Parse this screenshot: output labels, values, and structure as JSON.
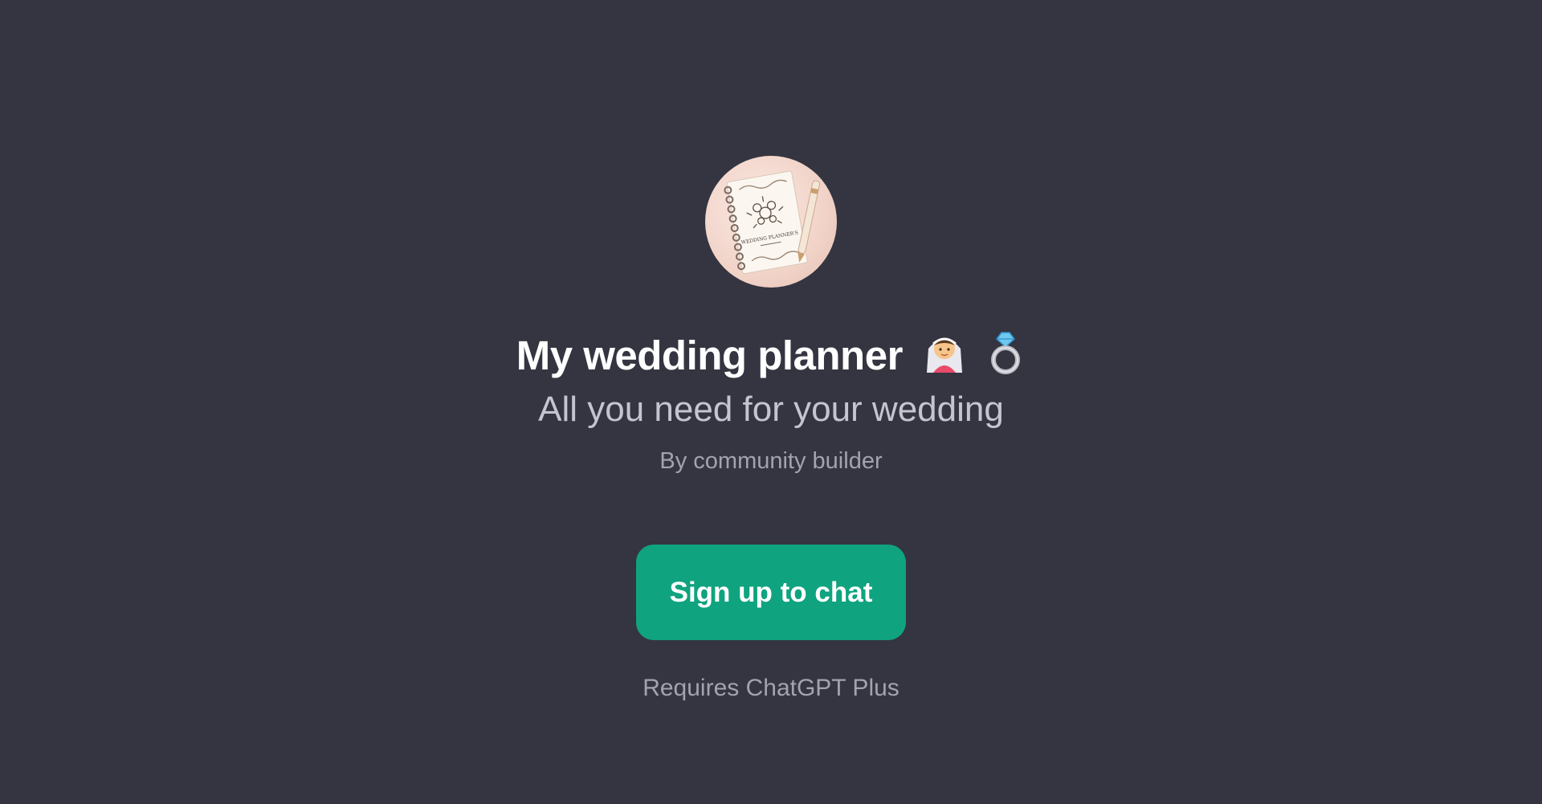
{
  "gpt": {
    "title": "My wedding planner",
    "title_emojis": [
      "bride-with-veil-icon",
      "ring-icon"
    ],
    "subtitle": "All you need for your wedding",
    "author": "By community builder",
    "avatar_text": "WEDDING PLANNER'S"
  },
  "cta": {
    "label": "Sign up to chat",
    "color": "#10a37f"
  },
  "footer": {
    "note": "Requires ChatGPT Plus"
  },
  "colors": {
    "background": "#343541",
    "title": "#ffffff",
    "subtitle": "#c5c5d2",
    "muted": "#a3a3ae"
  }
}
